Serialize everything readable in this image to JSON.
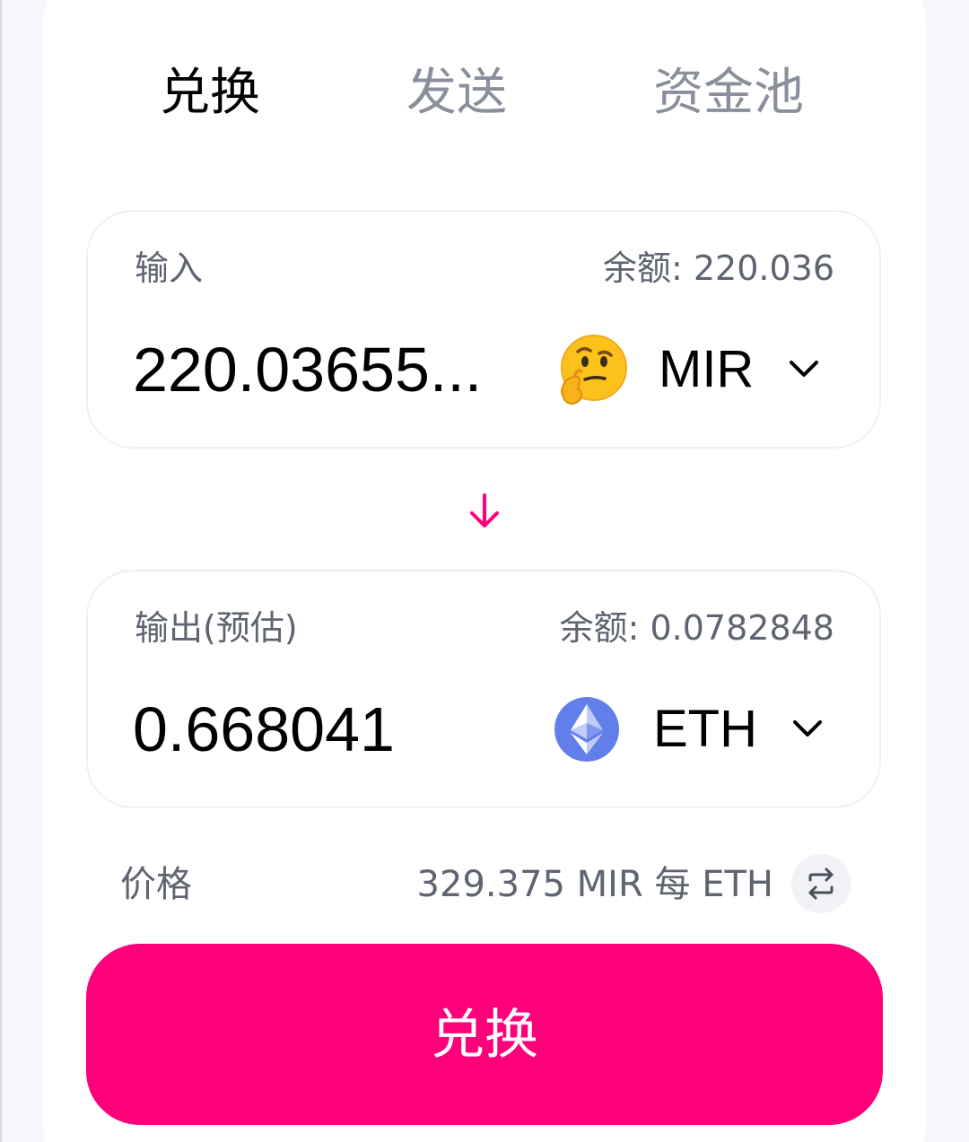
{
  "tabs": [
    {
      "label": "兑换",
      "active": true
    },
    {
      "label": "发送",
      "active": false
    },
    {
      "label": "资金池",
      "active": false
    }
  ],
  "input_panel": {
    "label": "输入",
    "balance": "余额: 220.036",
    "amount": "220.03655...",
    "token": {
      "symbol": "MIR",
      "icon": "thinking-face-icon"
    }
  },
  "output_panel": {
    "label": "输出(预估)",
    "balance": "余额: 0.0782848",
    "amount": "0.668041",
    "token": {
      "symbol": "ETH",
      "icon": "ethereum-icon"
    }
  },
  "price": {
    "label": "价格",
    "value": "329.375 MIR 每 ETH"
  },
  "swap_button": {
    "label": "兑换"
  },
  "colors": {
    "accent": "#ff007a",
    "eth": "#627eea",
    "muted_text": "#5e6470",
    "inactive_tab": "#8a8f9c"
  }
}
